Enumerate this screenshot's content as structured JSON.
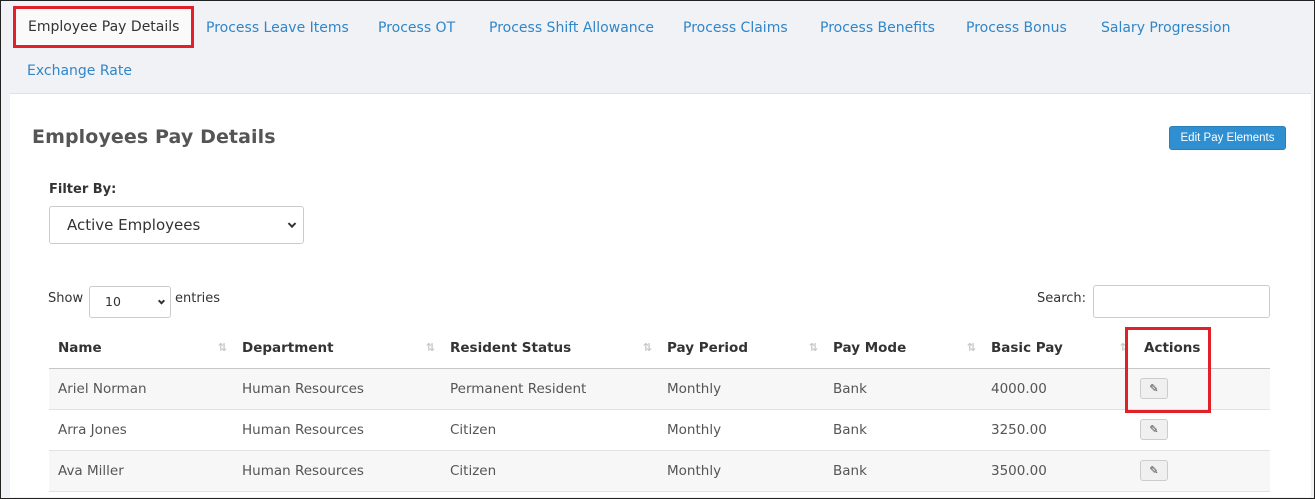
{
  "tabs": [
    {
      "label": "Employee Pay Details",
      "active": true
    },
    {
      "label": "Process Leave Items"
    },
    {
      "label": "Process OT"
    },
    {
      "label": "Process Shift Allowance"
    },
    {
      "label": "Process Claims"
    },
    {
      "label": "Process Benefits"
    },
    {
      "label": "Process Bonus"
    },
    {
      "label": "Salary Progression"
    },
    {
      "label": "Exchange Rate"
    }
  ],
  "page": {
    "title": "Employees Pay Details",
    "edit_button_label": "Edit Pay Elements"
  },
  "filter": {
    "label": "Filter By:",
    "selected": "Active Employees"
  },
  "table_controls": {
    "show_label": "Show",
    "entries_value": "10",
    "entries_label": "entries",
    "search_label": "Search:",
    "search_value": ""
  },
  "table": {
    "columns": [
      "Name",
      "Department",
      "Resident Status",
      "Pay Period",
      "Pay Mode",
      "Basic Pay",
      "Actions"
    ],
    "rows": [
      {
        "name": "Ariel Norman",
        "department": "Human Resources",
        "resident_status": "Permanent Resident",
        "pay_period": "Monthly",
        "pay_mode": "Bank",
        "basic_pay": "4000.00"
      },
      {
        "name": "Arra Jones",
        "department": "Human Resources",
        "resident_status": "Citizen",
        "pay_period": "Monthly",
        "pay_mode": "Bank",
        "basic_pay": "3250.00"
      },
      {
        "name": "Ava Miller",
        "department": "Human Resources",
        "resident_status": "Citizen",
        "pay_period": "Monthly",
        "pay_mode": "Bank",
        "basic_pay": "3500.00"
      }
    ]
  },
  "icons": {
    "sort": "sort-icon",
    "edit": "pencil-icon"
  },
  "colors": {
    "link": "#2f86c8",
    "highlight": "#e3202a",
    "button": "#2f8fd0"
  }
}
